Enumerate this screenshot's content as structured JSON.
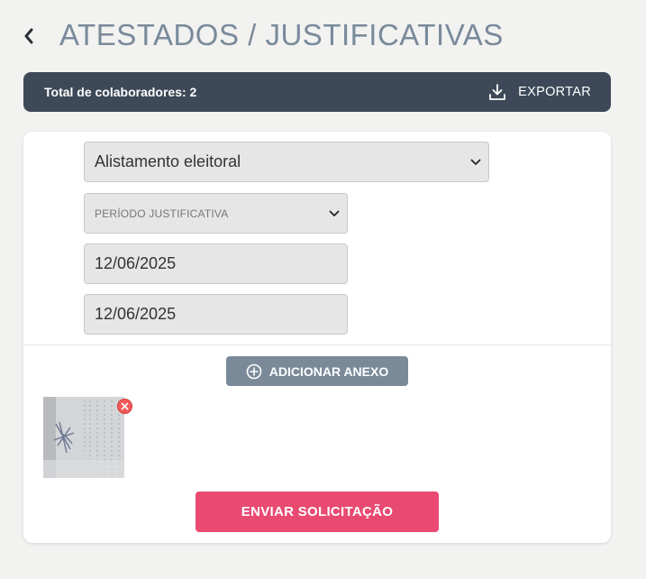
{
  "header": {
    "title": "ATESTADOS / JUSTIFICATIVAS",
    "back_icon": "chevron-left-icon"
  },
  "summary": {
    "total_label": "Total de colaboradores: 2",
    "export_label": "EXPORTAR",
    "export_icon": "download-icon",
    "bar_color": "#3d4958"
  },
  "form": {
    "justification_type": "Alistamento eleitoral",
    "period_placeholder": "PERÍODO JUSTIFICATIVA",
    "start_date": "12/06/2025",
    "end_date": "12/06/2025"
  },
  "attachments": {
    "add_label": "ADICIONAR ANEXO",
    "add_icon": "plus-circle-icon",
    "remove_icon": "close-circle-icon"
  },
  "actions": {
    "submit_label": "ENVIAR SOLICITAÇÃO",
    "submit_color": "#e84a72"
  }
}
